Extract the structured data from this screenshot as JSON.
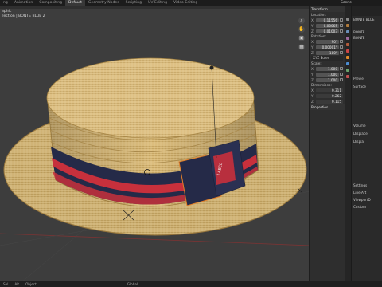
{
  "topbar": {
    "tabs": [
      "ng",
      "Animation",
      "Compositing",
      "Default",
      "Geometry Nodes",
      "Scripting",
      "UV Editing",
      "Video Editing"
    ],
    "active_tab": "Default",
    "scene_label": "Scene"
  },
  "viewport": {
    "info_line1": "aphic",
    "info_line2": "llection | BONTE BLUE 2"
  },
  "npanel": {
    "header": "Transform",
    "location_label": "Location:",
    "location": [
      {
        "axis": "X",
        "value": "0.11556"
      },
      {
        "axis": "Y",
        "value": "0.00065"
      },
      {
        "axis": "Z",
        "value": "0.01003"
      }
    ],
    "rotation_label": "Rotation:",
    "rotation": [
      {
        "axis": "X",
        "value": "90°"
      },
      {
        "axis": "Y",
        "value": "0.00001°"
      },
      {
        "axis": "Z",
        "value": "180°"
      }
    ],
    "rotation_mode": "XYZ Euler",
    "scale_label": "Scale:",
    "scale": [
      {
        "axis": "X",
        "value": "1.000"
      },
      {
        "axis": "Y",
        "value": "1.000"
      },
      {
        "axis": "Z",
        "value": "1.000"
      }
    ],
    "dimensions_label": "Dimensions:",
    "dimensions": [
      {
        "axis": "X",
        "value": "0.311"
      },
      {
        "axis": "Y",
        "value": "0.262"
      },
      {
        "axis": "Z",
        "value": "0.115"
      }
    ],
    "properties_label": "Properties"
  },
  "props_panel": {
    "rows": [
      "BONTE BLUE",
      "BONTE",
      "BONTE",
      "Previe",
      "Surface",
      "Volume",
      "Displace",
      "Displa",
      "Settings",
      "Line Art",
      "ViewportD",
      "Custom"
    ]
  },
  "statusbar": {
    "items": [
      "Sel",
      "Alt",
      "Object",
      "Global"
    ]
  },
  "colors": {
    "straw": "#d9b878",
    "band_red": "#c8303c",
    "band_navy": "#252a48",
    "viewport_bg": "#3d3d3d"
  }
}
